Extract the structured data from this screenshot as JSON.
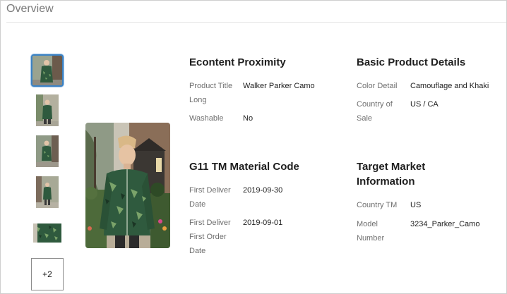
{
  "header": {
    "title": "Overview"
  },
  "thumbnails": {
    "more_label": "+2"
  },
  "econtent": {
    "title": "Econtent Proximity",
    "fields": [
      {
        "label": "Product Title Long",
        "value": "Walker Parker Camo"
      },
      {
        "label": "Washable",
        "value": "No"
      }
    ]
  },
  "basic": {
    "title": "Basic Product Details",
    "fields": [
      {
        "label": "Color Detail",
        "value": "Camouflage and Khaki"
      },
      {
        "label": "Country of Sale",
        "value": "US / CA"
      }
    ]
  },
  "g11": {
    "title": "G11 TM Material Code",
    "fields": [
      {
        "label": "First Deliver Date",
        "value": "2019-09-30"
      },
      {
        "label": "First Deliver First Order Date",
        "value": "2019-09-01"
      }
    ]
  },
  "target": {
    "title": "Target Market Information",
    "fields": [
      {
        "label": "Country TM",
        "value": "US"
      },
      {
        "label": "Model Number",
        "value": "3234_Parker_Camo"
      }
    ]
  },
  "colors": {
    "accent": "#3b82c4",
    "jacket": "#2f5a3e",
    "border": "#cfcfcf"
  }
}
